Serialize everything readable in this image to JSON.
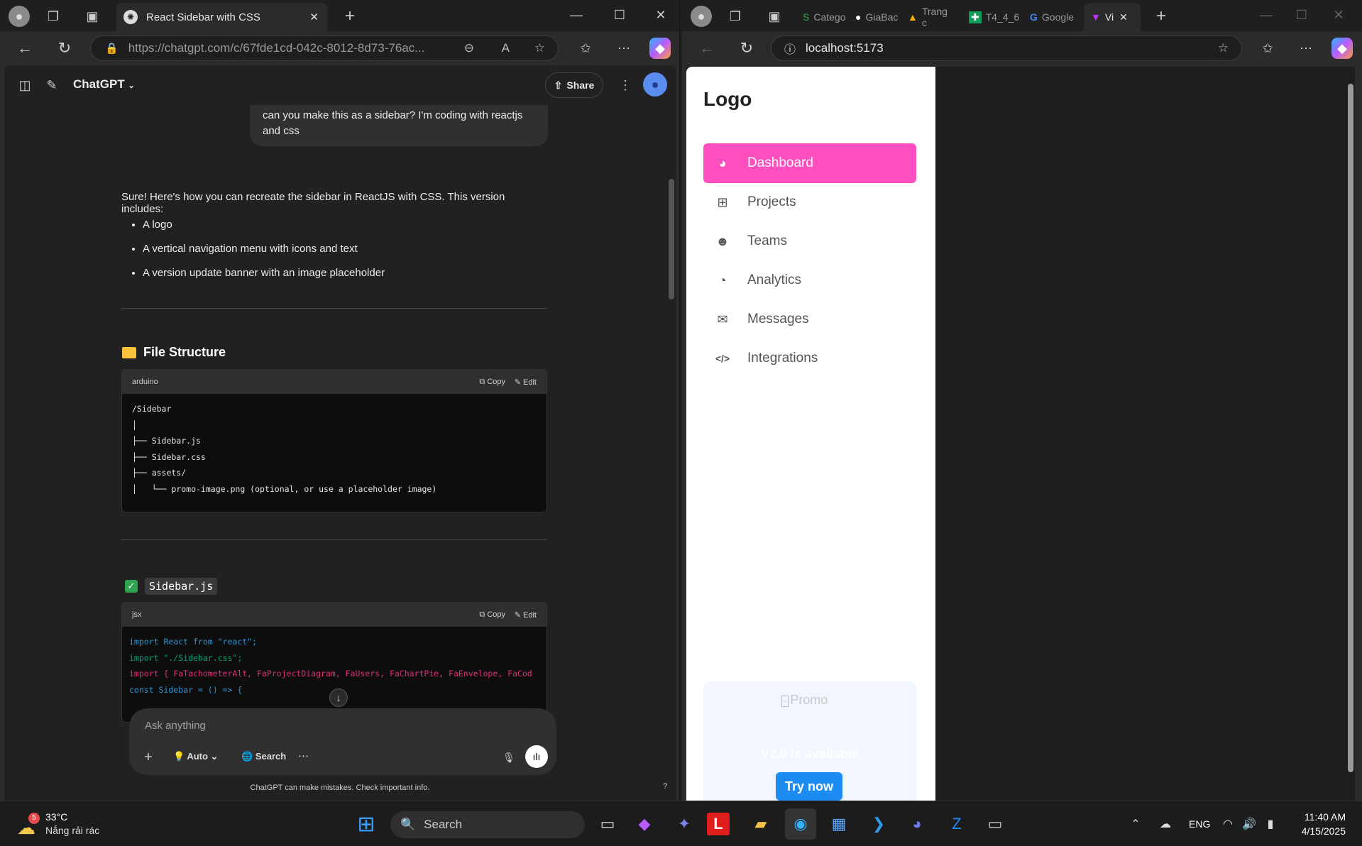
{
  "left_window": {
    "tab_title": "React Sidebar with CSS",
    "url": "https://chatgpt.com/c/67fde1cd-042c-8012-8d73-76ac...",
    "app_name": "ChatGPT",
    "share_label": "Share",
    "user_message": "can you make this as a sidebar? I'm coding with reactjs and css",
    "intro": "Sure! Here's how you can recreate the sidebar in ReactJS with CSS. This version includes:",
    "bullets": [
      "A logo",
      "A vertical navigation menu with icons and text",
      "A version update banner with an image placeholder"
    ],
    "section1_title": "File Structure",
    "code1": {
      "lang": "arduino",
      "copy": "Copy",
      "edit": "Edit",
      "lines": [
        "/Sidebar",
        "│",
        "├── Sidebar.js",
        "├── Sidebar.css",
        "├── assets/",
        "│   └── promo-image.png (optional, or use a placeholder image)"
      ]
    },
    "section2_title": "Sidebar.js",
    "code2": {
      "lang": "jsx",
      "copy": "Copy",
      "edit": "Edit",
      "lines": [
        "import React from \"react\";",
        "import \"./Sidebar.css\";",
        "import { FaTachometerAlt, FaProjectDiagram, FaUsers, FaChartPie, FaEnvelope, FaCod",
        "",
        "const Sidebar = () => {"
      ]
    },
    "composer_placeholder": "Ask anything",
    "auto_label": "Auto",
    "search_label": "Search",
    "disclaimer": "ChatGPT can make mistakes. Check important info.",
    "help": "?"
  },
  "right_window": {
    "tabs": [
      "Catego",
      "GiaBac",
      "Trang c",
      "T4_4_6",
      "Google",
      "Vi"
    ],
    "url": "localhost:5173",
    "sidebar": {
      "logo": "Logo",
      "items": [
        {
          "label": "Dashboard",
          "icon": "tachometer-icon",
          "glyph": "◕"
        },
        {
          "label": "Projects",
          "icon": "project-diagram-icon",
          "glyph": "⊞"
        },
        {
          "label": "Teams",
          "icon": "users-icon",
          "glyph": "☻"
        },
        {
          "label": "Analytics",
          "icon": "chart-pie-icon",
          "glyph": "◔"
        },
        {
          "label": "Messages",
          "icon": "envelope-icon",
          "glyph": "✉"
        },
        {
          "label": "Integrations",
          "icon": "code-icon",
          "glyph": "</>"
        }
      ],
      "promo_alt": "Promo",
      "promo_text": "V2.0 is available",
      "promo_button": "Try now",
      "active_color": "#ff4fbf"
    }
  },
  "taskbar": {
    "weather_temp": "33°C",
    "weather_desc": "Nắng rải rác",
    "weather_badge": "5",
    "search": "Search",
    "lang": "ENG",
    "time": "11:40 AM",
    "date": "4/15/2025"
  }
}
